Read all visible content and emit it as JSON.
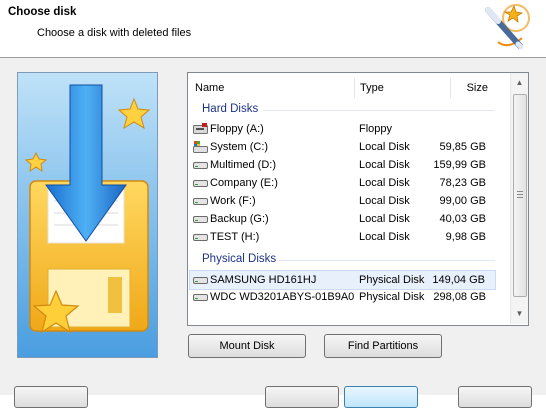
{
  "header": {
    "title": "Choose disk",
    "subtitle": "Choose a disk with deleted files",
    "icon": "magic-wand-icon"
  },
  "list": {
    "columns": {
      "name": "Name",
      "type": "Type",
      "size": "Size"
    },
    "groups": [
      {
        "label": "Hard Disks",
        "rows": [
          {
            "name": "Floppy (A:)",
            "type": "Floppy",
            "size": "",
            "icon": "floppy-drive-icon"
          },
          {
            "name": "System (C:)",
            "type": "Local Disk",
            "size": "59,85 GB",
            "icon": "system-drive-icon"
          },
          {
            "name": "Multimed (D:)",
            "type": "Local Disk",
            "size": "159,99 GB",
            "icon": "hard-drive-icon"
          },
          {
            "name": "Company (E:)",
            "type": "Local Disk",
            "size": "78,23 GB",
            "icon": "hard-drive-icon"
          },
          {
            "name": "Work (F:)",
            "type": "Local Disk",
            "size": "99,00 GB",
            "icon": "hard-drive-icon"
          },
          {
            "name": "Backup (G:)",
            "type": "Local Disk",
            "size": "40,03 GB",
            "icon": "hard-drive-icon"
          },
          {
            "name": "TEST (H:)",
            "type": "Local Disk",
            "size": "9,98 GB",
            "icon": "hard-drive-icon"
          }
        ]
      },
      {
        "label": "Physical Disks",
        "rows": [
          {
            "name": "SAMSUNG HD161HJ",
            "type": "Physical Disk",
            "size": "149,04 GB",
            "icon": "hard-drive-icon",
            "selected": true
          },
          {
            "name": "WDC WD3201ABYS-01B9A0",
            "type": "Physical Disk",
            "size": "298,08 GB",
            "icon": "hard-drive-icon"
          }
        ]
      }
    ]
  },
  "buttons": {
    "mount_disk": "Mount Disk",
    "find_partitions": "Find Partitions"
  },
  "colors": {
    "group_text": "#1e3287",
    "selected_row": "#e8f1fb",
    "image_blue": "#2e8fe0",
    "image_yellow": "#f3b81f"
  }
}
